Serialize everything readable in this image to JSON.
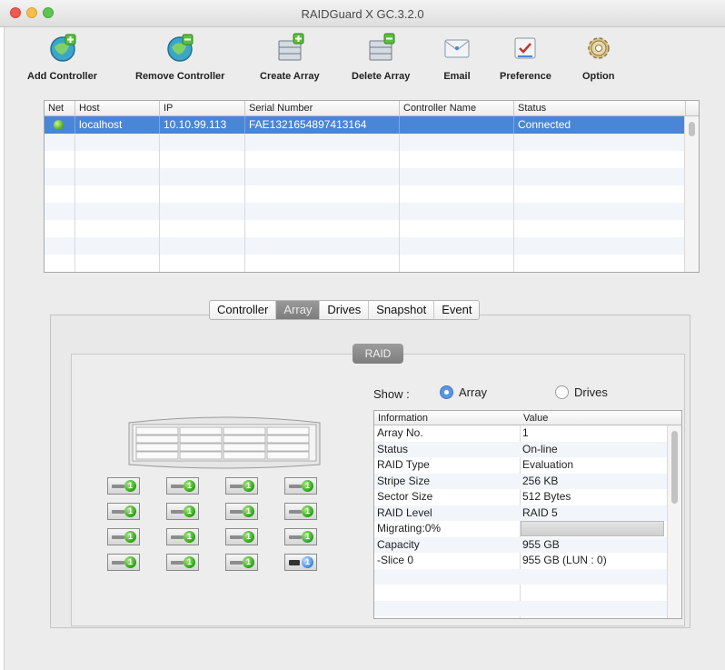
{
  "window": {
    "title": "RAIDGuard X GC.3.2.0"
  },
  "toolbar": {
    "buttons": [
      {
        "label": "Add Controller",
        "icon": "add-controller-icon"
      },
      {
        "label": "Remove Controller",
        "icon": "remove-controller-icon"
      },
      {
        "label": "Create Array",
        "icon": "create-array-icon"
      },
      {
        "label": "Delete Array",
        "icon": "delete-array-icon"
      },
      {
        "label": "Email",
        "icon": "email-icon"
      },
      {
        "label": "Preference",
        "icon": "preference-icon"
      },
      {
        "label": "Option",
        "icon": "gear-icon"
      }
    ]
  },
  "controllers": {
    "columns": [
      "Net",
      "Host",
      "IP",
      "Serial Number",
      "Controller Name",
      "Status"
    ],
    "rows": [
      {
        "net": "online",
        "host": "localhost",
        "ip": "10.10.99.113",
        "serial": "FAE1321654897413164",
        "name": "",
        "status": "Connected"
      }
    ]
  },
  "tabs": {
    "items": [
      "Controller",
      "Array",
      "Drives",
      "Snapshot",
      "Event"
    ],
    "active": "Array"
  },
  "raid": {
    "section_label": "RAID",
    "show_label": "Show :",
    "options": [
      {
        "label": "Array",
        "selected": true
      },
      {
        "label": "Drives",
        "selected": false
      }
    ],
    "bay_led_text": "1",
    "info": {
      "columns": [
        "Information",
        "Value"
      ],
      "rows": [
        {
          "info": "Array No.",
          "value": "1"
        },
        {
          "info": "Status",
          "value": "On-line"
        },
        {
          "info": "RAID Type",
          "value": "Evaluation"
        },
        {
          "info": "Stripe Size",
          "value": "256 KB"
        },
        {
          "info": "Sector Size",
          "value": "512 Bytes"
        },
        {
          "info": "RAID Level",
          "value": "RAID 5"
        },
        {
          "info": "Migrating:0%",
          "value": ""
        },
        {
          "info": "Capacity",
          "value": "955 GB"
        },
        {
          "info": "-Slice 0",
          "value": " 955 GB (LUN : 0)"
        }
      ]
    }
  },
  "colors": {
    "selection": "#4a86d6",
    "drive_ok": "#27a313",
    "drive_spare": "#3f86d6",
    "tab_active": "#8a8a8a"
  }
}
